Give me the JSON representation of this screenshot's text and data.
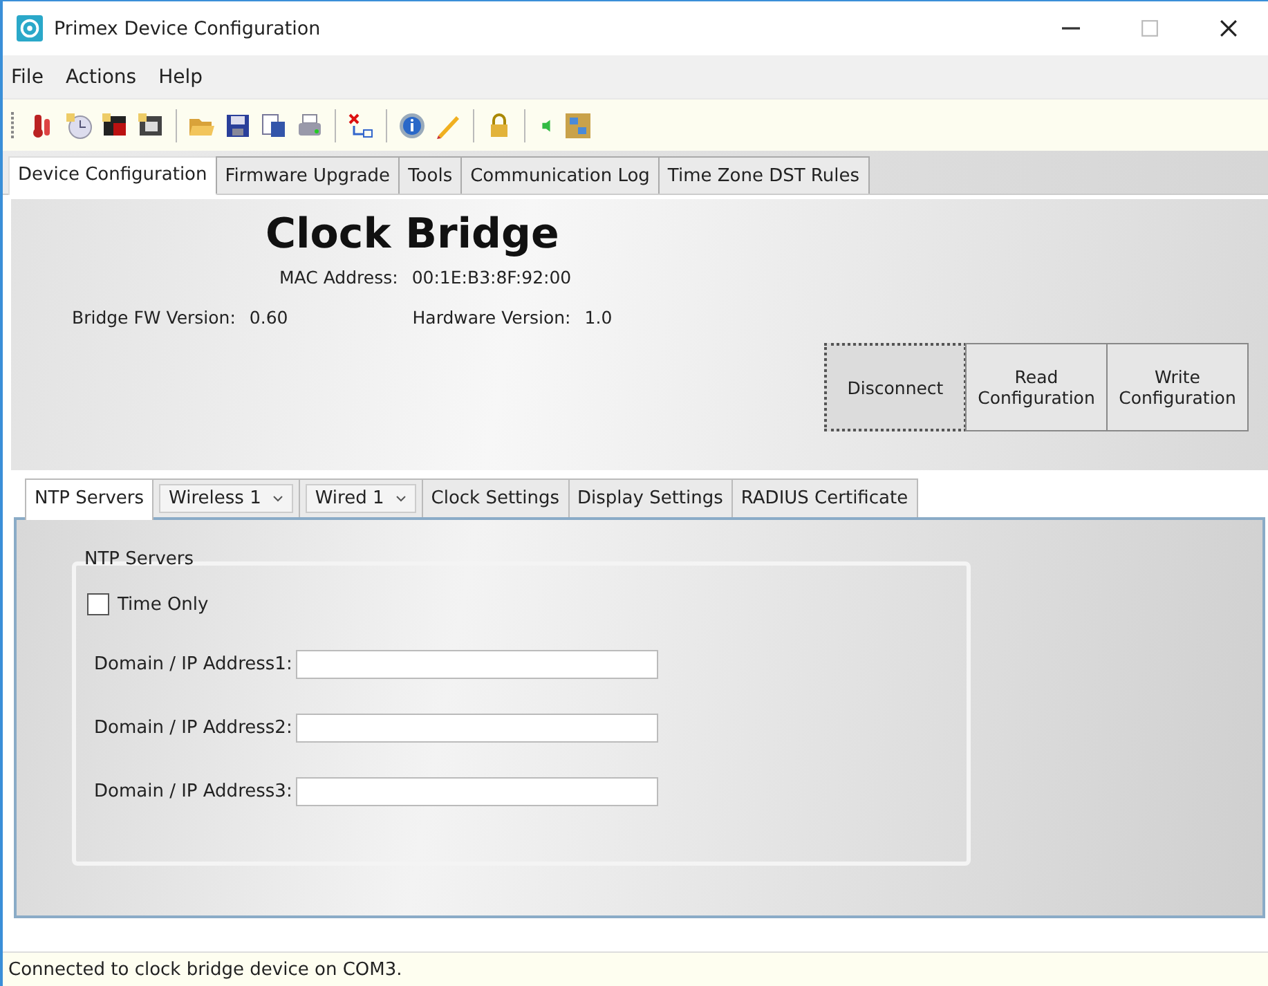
{
  "window": {
    "title": "Primex Device Configuration"
  },
  "menu": [
    "File",
    "Actions",
    "Help"
  ],
  "tabs": [
    {
      "label": "Device Configuration",
      "selected": true
    },
    {
      "label": "Firmware Upgrade",
      "selected": false
    },
    {
      "label": "Tools",
      "selected": false
    },
    {
      "label": "Communication Log",
      "selected": false
    },
    {
      "label": "Time Zone DST Rules",
      "selected": false
    }
  ],
  "device": {
    "name": "Clock Bridge",
    "mac_label": "MAC Address:",
    "mac": "00:1E:B3:8F:92:00",
    "fw_label": "Bridge FW Version:",
    "fw": "0.60",
    "hw_label": "Hardware Version:",
    "hw": "1.0"
  },
  "actions": [
    {
      "label": "Disconnect",
      "focused": true
    },
    {
      "label": "Read Configuration",
      "focused": false
    },
    {
      "label": "Write Configuration",
      "focused": false
    }
  ],
  "subtabs": [
    {
      "label": "NTP Servers",
      "kind": "tab",
      "selected": true
    },
    {
      "label": "Wireless 1",
      "kind": "dropdown",
      "selected": false
    },
    {
      "label": "Wired 1",
      "kind": "dropdown",
      "selected": false
    },
    {
      "label": "Clock Settings",
      "kind": "tab",
      "selected": false
    },
    {
      "label": "Display Settings",
      "kind": "tab",
      "selected": false
    },
    {
      "label": "RADIUS Certificate",
      "kind": "tab",
      "selected": false
    }
  ],
  "ntp": {
    "legend": "NTP Servers",
    "time_only": {
      "label": "Time Only",
      "checked": false
    },
    "fields": [
      {
        "label": "Domain / IP Address1:"
      },
      {
        "label": "Domain / IP Address2:"
      },
      {
        "label": "Domain / IP Address3:"
      }
    ]
  },
  "status_bar": "Connected to clock bridge device on COM3."
}
